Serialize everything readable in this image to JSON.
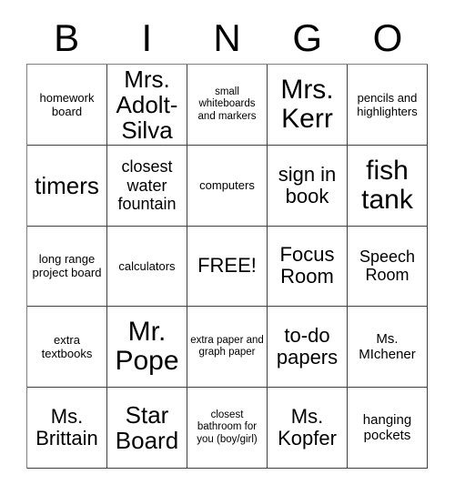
{
  "card": {
    "title_letters": [
      "B",
      "I",
      "N",
      "G",
      "O"
    ],
    "colors": {
      "text": "#000000",
      "border": "#404040",
      "background": "#ffffff"
    },
    "free_space": {
      "row": 3,
      "column": 3,
      "label": "FREE!"
    },
    "grid": {
      "rows": 5,
      "columns": 5,
      "cells": [
        [
          {
            "text": "homework board",
            "size": "sm"
          },
          {
            "text": "Mrs. Adolt-Silva",
            "size": "xxl"
          },
          {
            "text": "small whiteboards and markers",
            "size": "xs"
          },
          {
            "text": "Mrs. Kerr",
            "size": "huge"
          },
          {
            "text": "pencils and highlighters",
            "size": "sm"
          }
        ],
        [
          {
            "text": "timers",
            "size": "xxl"
          },
          {
            "text": "closest water fountain",
            "size": "lg"
          },
          {
            "text": "computers",
            "size": "sm"
          },
          {
            "text": "sign in book",
            "size": "xl"
          },
          {
            "text": "fish tank",
            "size": "huge"
          }
        ],
        [
          {
            "text": "long range project board",
            "size": "sm"
          },
          {
            "text": "calculators",
            "size": "sm"
          },
          {
            "text": "FREE!",
            "size": "xl"
          },
          {
            "text": "Focus Room",
            "size": "xl"
          },
          {
            "text": "Speech Room",
            "size": "lg"
          }
        ],
        [
          {
            "text": "extra textbooks",
            "size": "sm"
          },
          {
            "text": "Mr. Pope",
            "size": "huge"
          },
          {
            "text": "extra paper and graph paper",
            "size": "xs"
          },
          {
            "text": "to-do papers",
            "size": "xl"
          },
          {
            "text": "Ms. MIchener",
            "size": "md"
          }
        ],
        [
          {
            "text": "Ms. Brittain",
            "size": "xl"
          },
          {
            "text": "Star Board",
            "size": "xxl"
          },
          {
            "text": "closest bathroom for you (boy/girl)",
            "size": "xs"
          },
          {
            "text": "Ms. Kopfer",
            "size": "xl"
          },
          {
            "text": "hanging pockets",
            "size": "md"
          }
        ]
      ]
    }
  }
}
